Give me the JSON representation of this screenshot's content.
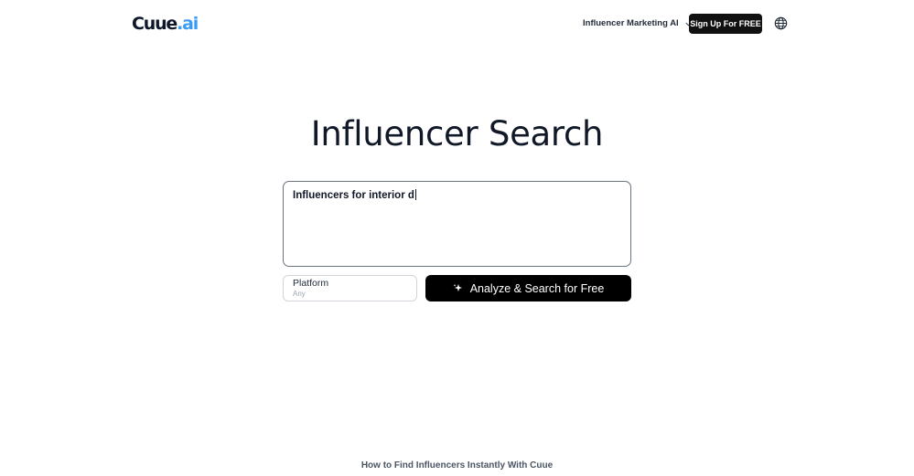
{
  "header": {
    "logo_main": "Cuue",
    "logo_accent": ".ai",
    "nav_label": "Influencer Marketing AI",
    "signup_label": "Sign Up For FREE"
  },
  "icons": {
    "nav_chevron": "chevron-down-icon",
    "language": "globe-icon",
    "analyze": "sparkle-icon"
  },
  "hero": {
    "title": "Influencer Search",
    "query_value": "Influencers for interior d",
    "platform_label": "Platform",
    "platform_value": "Any",
    "analyze_label": "Analyze & Search for Free"
  },
  "footer": {
    "section_heading": "How to Find Influencers Instantly With Cuue"
  },
  "colors": {
    "accent": "#3b9cf5",
    "primary_button": "#111111",
    "text": "#111827"
  }
}
